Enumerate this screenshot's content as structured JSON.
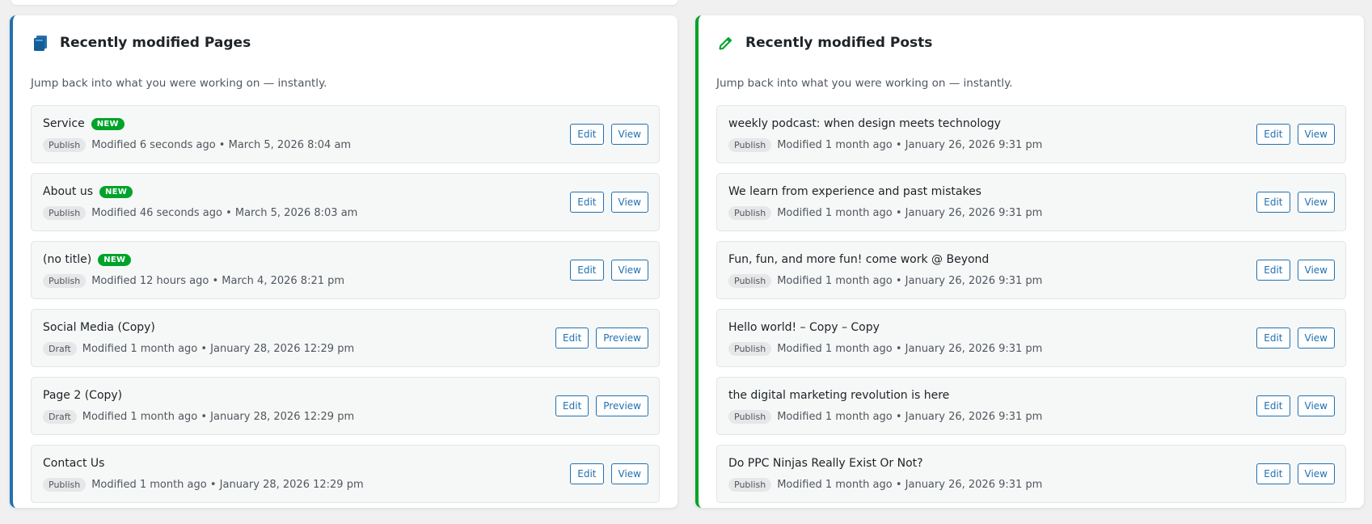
{
  "pages": {
    "title": "Recently modified Pages",
    "subtitle": "Jump back into what you were working on — instantly.",
    "icon": "book-icon",
    "accent": "#2271b1",
    "items": [
      {
        "title": "Service",
        "is_new": true,
        "new_label": "NEW",
        "status": "Publish",
        "meta": "Modified 6 seconds ago • March 5, 2026 8:04 am",
        "edit_label": "Edit",
        "view_label": "View"
      },
      {
        "title": "About us",
        "is_new": true,
        "new_label": "NEW",
        "status": "Publish",
        "meta": "Modified 46 seconds ago • March 5, 2026 8:03 am",
        "edit_label": "Edit",
        "view_label": "View"
      },
      {
        "title": "(no title)",
        "is_new": true,
        "new_label": "NEW",
        "status": "Publish",
        "meta": "Modified 12 hours ago • March 4, 2026 8:21 pm",
        "edit_label": "Edit",
        "view_label": "View"
      },
      {
        "title": "Social Media (Copy)",
        "is_new": false,
        "status": "Draft",
        "meta": "Modified 1 month ago • January 28, 2026 12:29 pm",
        "edit_label": "Edit",
        "view_label": "Preview"
      },
      {
        "title": "Page 2 (Copy)",
        "is_new": false,
        "status": "Draft",
        "meta": "Modified 1 month ago • January 28, 2026 12:29 pm",
        "edit_label": "Edit",
        "view_label": "Preview"
      },
      {
        "title": "Contact Us",
        "is_new": false,
        "status": "Publish",
        "meta": "Modified 1 month ago • January 28, 2026 12:29 pm",
        "edit_label": "Edit",
        "view_label": "View"
      }
    ]
  },
  "posts": {
    "title": "Recently modified Posts",
    "subtitle": "Jump back into what you were working on — instantly.",
    "icon": "pencil-icon",
    "accent": "#00a32a",
    "items": [
      {
        "title": "weekly podcast: when design meets technology",
        "is_new": false,
        "status": "Publish",
        "meta": "Modified 1 month ago • January 26, 2026 9:31 pm",
        "edit_label": "Edit",
        "view_label": "View"
      },
      {
        "title": "We learn from experience and past mistakes",
        "is_new": false,
        "status": "Publish",
        "meta": "Modified 1 month ago • January 26, 2026 9:31 pm",
        "edit_label": "Edit",
        "view_label": "View"
      },
      {
        "title": "Fun, fun, and more fun! come work @ Beyond",
        "is_new": false,
        "status": "Publish",
        "meta": "Modified 1 month ago • January 26, 2026 9:31 pm",
        "edit_label": "Edit",
        "view_label": "View"
      },
      {
        "title": "Hello world! – Copy – Copy",
        "is_new": false,
        "status": "Publish",
        "meta": "Modified 1 month ago • January 26, 2026 9:31 pm",
        "edit_label": "Edit",
        "view_label": "View"
      },
      {
        "title": "the digital marketing revolution is here",
        "is_new": false,
        "status": "Publish",
        "meta": "Modified 1 month ago • January 26, 2026 9:31 pm",
        "edit_label": "Edit",
        "view_label": "View"
      },
      {
        "title": "Do PPC Ninjas Really Exist Or Not?",
        "is_new": false,
        "status": "Publish",
        "meta": "Modified 1 month ago • January 26, 2026 9:31 pm",
        "edit_label": "Edit",
        "view_label": "View"
      }
    ]
  }
}
